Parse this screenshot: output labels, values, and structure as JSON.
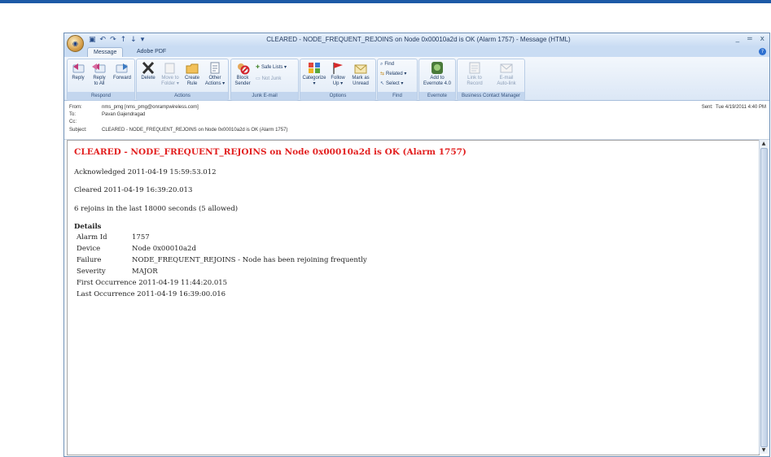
{
  "window": {
    "title": "CLEARED - NODE_FREQUENT_REJOINS on Node 0x00010a2d is OK (Alarm 1757) - Message (HTML)",
    "qat_icons": [
      "save-icon",
      "undo-icon",
      "redo-icon",
      "up-icon",
      "down-icon",
      "customize-icon"
    ],
    "controls": [
      "_",
      "=",
      "x"
    ]
  },
  "tabs": [
    {
      "label": "Message",
      "active": true
    },
    {
      "label": "Adobe PDF",
      "active": false
    }
  ],
  "ribbon": {
    "groups": {
      "respond": "Respond",
      "actions": "Actions",
      "junk": "Junk E-mail",
      "options": "Options",
      "find": "Find",
      "evernote": "Evernote",
      "bcm": "Business Contact Manager"
    },
    "buttons": {
      "reply": [
        "Reply",
        ""
      ],
      "reply_all": [
        "Reply",
        "to All"
      ],
      "forward": [
        "Forward",
        ""
      ],
      "delete": [
        "Delete",
        ""
      ],
      "move_to_folder": [
        "Move to",
        "Folder ▾"
      ],
      "create_rule": [
        "Create",
        "Rule"
      ],
      "other_actions": [
        "Other",
        "Actions ▾"
      ],
      "block_sender": [
        "Block",
        "Sender"
      ],
      "safe_lists": "Safe Lists ▾",
      "not_junk": "Not Junk",
      "categorize": [
        "Categorize",
        "▾"
      ],
      "follow_up": [
        "Follow",
        "Up ▾"
      ],
      "mark_unread": [
        "Mark as",
        "Unread"
      ],
      "find": "Find",
      "related": "Related ▾",
      "select": "Select ▾",
      "add_to_evernote": [
        "Add to",
        "Evernote 4.0"
      ],
      "link_to_record": [
        "Link to",
        "Record"
      ],
      "email_autolink": [
        "E-mail",
        "Auto-link"
      ]
    }
  },
  "header": {
    "from_label": "From:",
    "from": "nms_pmg [nms_pmg@onrampwireless.com]",
    "to_label": "To:",
    "to": "Pavan Gajendragad",
    "cc_label": "Cc:",
    "cc": "",
    "subject_label": "Subject:",
    "subject": "CLEARED - NODE_FREQUENT_REJOINS on Node 0x00010a2d is OK (Alarm 1757)",
    "sent_label": "Sent:",
    "sent": "Tue 4/19/2011 4:40 PM"
  },
  "message": {
    "headline": "CLEARED - NODE_FREQUENT_REJOINS on Node 0x00010a2d is OK (Alarm 1757)",
    "acknowledged": "Acknowledged 2011-04-19 15:59:53.012",
    "cleared": "Cleared 2011-04-19 16:39:20.013",
    "rejoins": "6 rejoins in the last 18000 seconds (5 allowed)",
    "details_heading": "Details",
    "details": [
      {
        "label": "Alarm Id",
        "value": "1757"
      },
      {
        "label": "Device",
        "value": "Node 0x00010a2d"
      },
      {
        "label": "Failure",
        "value": "NODE_FREQUENT_REJOINS - Node has been rejoining frequently"
      },
      {
        "label": "Severity",
        "value": "MAJOR"
      }
    ],
    "first_occurrence": "First Occurrence 2011-04-19 11:44:20.015",
    "last_occurrence": "Last Occurrence 2011-04-19 16:39:00.016"
  },
  "colors": {
    "alert": "#e21f1f",
    "accent": "#1d5aa6"
  }
}
